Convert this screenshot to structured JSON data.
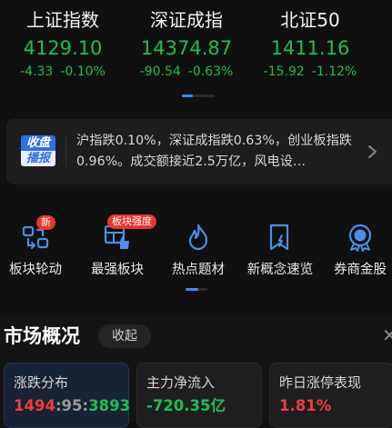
{
  "indices": [
    {
      "name": "上证指数",
      "value": "4129.10",
      "change": "-4.33",
      "pct": "-0.10%"
    },
    {
      "name": "深证成指",
      "value": "14374.87",
      "change": "-90.54",
      "pct": "-0.63%"
    },
    {
      "name": "北证50",
      "value": "1411.16",
      "change": "-15.92",
      "pct": "-1.12%"
    }
  ],
  "broadcast": {
    "badge_top": "收盘",
    "badge_bottom": "播报",
    "text": "沪指跌0.10%，深证成指跌0.63%，创业板指跌0.96%。成交额接近2.5万亿，风电设…",
    "arrow_icon": "chevron-right-icon"
  },
  "quick_entries": [
    {
      "label": "板块轮动",
      "icon": "rotation-icon",
      "badge": "新"
    },
    {
      "label": "最强板块",
      "icon": "strongest-sector-icon",
      "badge": "板块强度"
    },
    {
      "label": "热点题材",
      "icon": "flame-icon",
      "badge": ""
    },
    {
      "label": "新概念速览",
      "icon": "bookmark-bolt-icon",
      "badge": ""
    },
    {
      "label": "券商金股",
      "icon": "gold-stock-medal-icon",
      "badge": ""
    }
  ],
  "overview": {
    "title": "市场概况",
    "toggle": "收起",
    "close_icon": "close-icon",
    "cards": [
      {
        "title": "涨跌分布",
        "up": "1494",
        "sep1": ":",
        "flat": "95",
        "sep2": ":",
        "down": "3893"
      },
      {
        "title": "主力净流入",
        "value": "-720.35亿"
      },
      {
        "title": "昨日涨停表现",
        "value": "1.81%"
      }
    ]
  },
  "colors": {
    "up": "#f23b3b",
    "down": "#1fbe52",
    "accent": "#3a8ee8",
    "badge": "#e8352e"
  }
}
